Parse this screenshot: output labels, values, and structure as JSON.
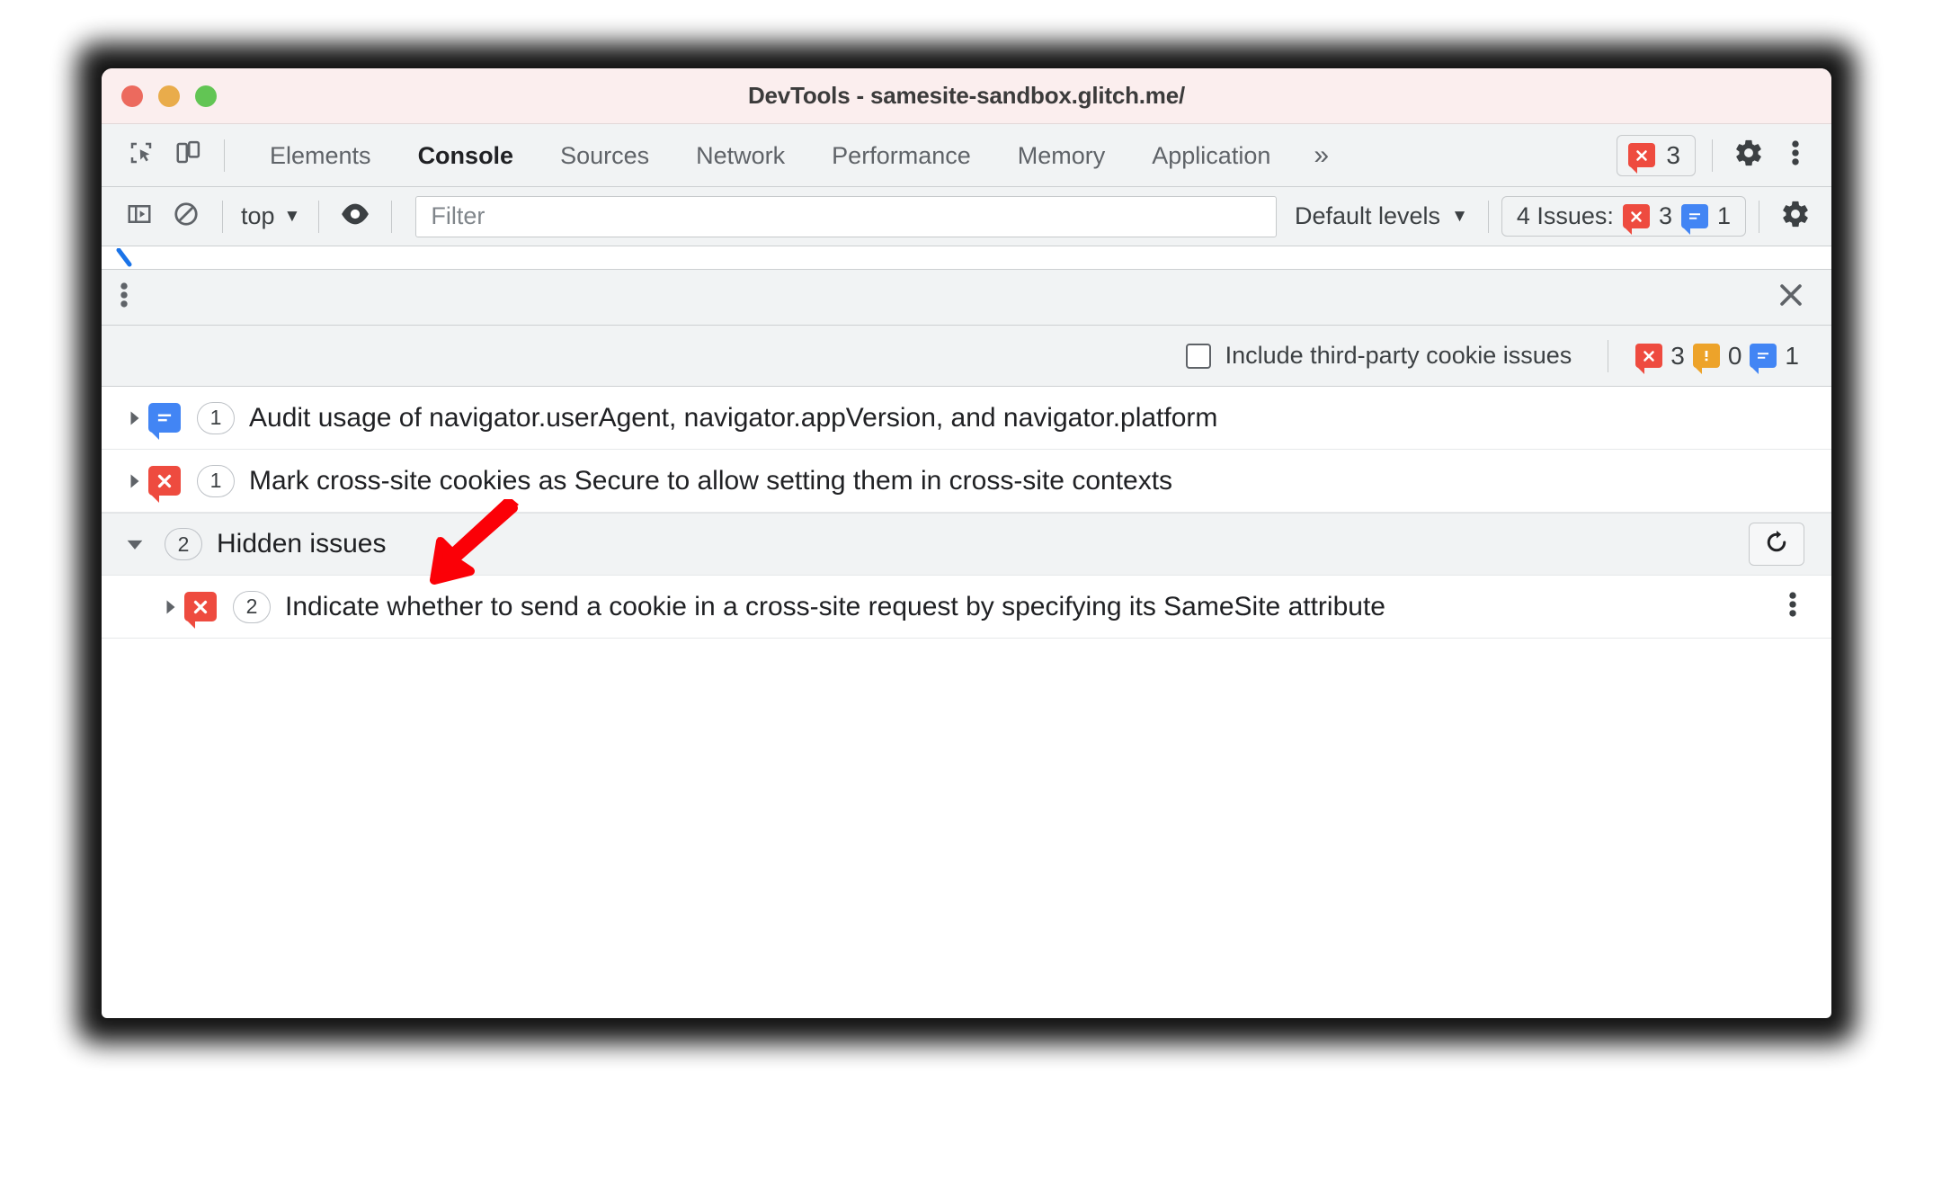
{
  "window": {
    "title": "DevTools - samesite-sandbox.glitch.me/",
    "traffic_lights": [
      "close",
      "minimize",
      "zoom"
    ],
    "colors": {
      "titlebar_bg": "#fbeeee",
      "toolbar_bg": "#f1f3f4",
      "error_red": "#ee4b3f",
      "info_blue": "#4285f4",
      "warning_orange": "#eda32a",
      "annotation_red": "#fb0007"
    }
  },
  "tabbar": {
    "inspect_icon": "inspect-element-icon",
    "device_icon": "device-toolbar-icon",
    "tabs": [
      {
        "label": "Elements",
        "active": false
      },
      {
        "label": "Console",
        "active": true
      },
      {
        "label": "Sources",
        "active": false
      },
      {
        "label": "Network",
        "active": false
      },
      {
        "label": "Performance",
        "active": false
      },
      {
        "label": "Memory",
        "active": false
      },
      {
        "label": "Application",
        "active": false
      }
    ],
    "overflow_label": "»",
    "error_count": "3",
    "settings_icon": "gear-icon",
    "more_icon": "kebab-menu-icon"
  },
  "console_toolbar": {
    "sidebar_toggle_icon": "console-sidebar-icon",
    "clear_icon": "clear-console-icon",
    "context": "top",
    "context_caret": "▼",
    "eye_icon": "live-expression-eye-icon",
    "filter_placeholder": "Filter",
    "filter_value": "",
    "levels_label": "Default levels",
    "levels_caret": "▼",
    "issues_label": "4 Issues:",
    "issues_error_count": "3",
    "issues_info_count": "1",
    "settings_icon": "gear-icon"
  },
  "drawer": {
    "menu_icon": "kebab-menu-icon",
    "close_icon": "close-icon",
    "third_party": {
      "checkbox_checked": false,
      "label": "Include third-party cookie issues",
      "error_count": "3",
      "warning_count": "0",
      "info_count": "1"
    }
  },
  "issues": [
    {
      "severity": "info",
      "expanded": false,
      "count": "1",
      "text": "Audit usage of navigator.userAgent, navigator.appVersion, and navigator.platform"
    },
    {
      "severity": "error",
      "expanded": false,
      "count": "1",
      "text": "Mark cross-site cookies as Secure to allow setting them in cross-site contexts"
    }
  ],
  "hidden_group": {
    "expanded": true,
    "caret": "▼",
    "count": "2",
    "label": "Hidden issues",
    "refresh_icon": "refresh-icon",
    "children": [
      {
        "severity": "error",
        "expanded": false,
        "count": "2",
        "text": "Indicate whether to send a cookie in a cross-site request by specifying its SameSite attribute",
        "menu_icon": "kebab-menu-icon"
      }
    ]
  },
  "annotation": {
    "arrow_icon": "red-pointer-arrow",
    "color": "#fb0007"
  }
}
